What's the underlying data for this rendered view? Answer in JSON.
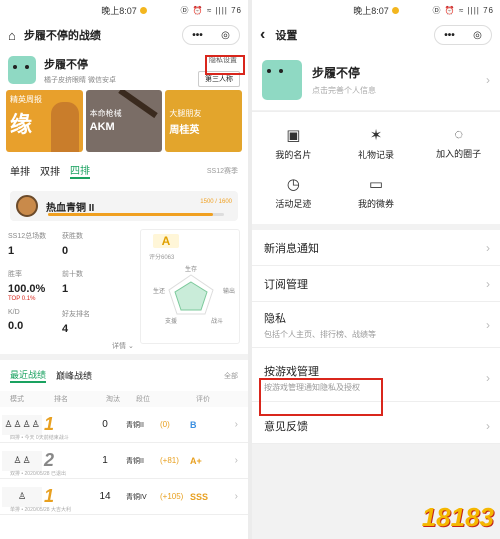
{
  "status": {
    "time": "晚上8:07",
    "signal": "Ⓓ ⏰ ≈ |||| 76"
  },
  "left": {
    "nav_title": "步履不停的战绩",
    "capsule_more": "•••",
    "capsule_close": "◎",
    "privacy_link": "隐私设置",
    "name": "步履不停",
    "subtitle": "橘子皮挤眼睛  微信安卓",
    "third_person": "第三人称",
    "banners": [
      {
        "tag": "精英周报",
        "big": "缘"
      },
      {
        "tag": "本命枪械",
        "big": "AKM"
      },
      {
        "tag": "大腿朋友",
        "big": "周桂英"
      }
    ],
    "mode_tabs": [
      "单排",
      "双排",
      "四排"
    ],
    "season": "SS12赛季",
    "rank_name": "热血青铜 II",
    "rank_progress": "1500 / 1600",
    "rank_fraction": 0.94,
    "stats": [
      {
        "label": "SS12总场数",
        "value": "1"
      },
      {
        "label": "获胜数",
        "value": "0"
      },
      {
        "label": "胜率",
        "value": "100.0%",
        "sub": "TOP 0.1%"
      },
      {
        "label": "前十数",
        "value": "1"
      },
      {
        "label": "K/D",
        "value": "0.0"
      },
      {
        "label": "好友排名",
        "value": "4"
      }
    ],
    "grade": "A",
    "score": "评分6063",
    "radar_labels": [
      "生存",
      "输出",
      "战斗",
      "支援",
      "生还"
    ],
    "detail": "详情",
    "match_tabs": [
      "最近战绩",
      "巅峰战绩"
    ],
    "filter": "全部",
    "table_headers": [
      "模式",
      "排名",
      "淘汰",
      "段位",
      "评价"
    ],
    "rows": [
      {
        "mode": "四排",
        "rank": "1",
        "kills": "0",
        "tier": "青铜II",
        "delta": "(0)",
        "eval": "B",
        "note": "四排 • 今天 0天前结束战斗"
      },
      {
        "mode": "双排",
        "rank": "2",
        "kills": "1",
        "tier": "青铜II",
        "delta": "(+81)",
        "eval": "A+",
        "note": "双排 • 2020/05/28 已退出"
      },
      {
        "mode": "单排",
        "rank": "1",
        "kills": "14",
        "tier": "青铜IV",
        "delta": "(+105)",
        "eval": "SSS",
        "note": "单排 • 2020/05/28 大吉大利"
      }
    ]
  },
  "right": {
    "back": "‹",
    "nav_title": "设置",
    "name": "步履不停",
    "hint": "点击完善个人信息",
    "icons": [
      {
        "label": "我的名片",
        "glyph": "▣"
      },
      {
        "label": "礼物记录",
        "glyph": "✶"
      },
      {
        "label": "加入的圈子",
        "glyph": "◌"
      },
      {
        "label": "活动足迹",
        "glyph": "◷"
      },
      {
        "label": "我的微券",
        "glyph": "▭"
      }
    ],
    "list": [
      {
        "title": "新消息通知",
        "sub": ""
      },
      {
        "title": "订阅管理",
        "sub": ""
      },
      {
        "title": "隐私",
        "sub": "包括个人主页、排行榜、战绩等"
      },
      {
        "title": "按游戏管理",
        "sub": "按游戏管理通知隐私及授权"
      },
      {
        "title": "意见反馈",
        "sub": ""
      }
    ],
    "watermark": "18183"
  },
  "colors": {
    "accent": "#1aa260",
    "highlight": "#d9261c",
    "gold": "#f0a020"
  }
}
